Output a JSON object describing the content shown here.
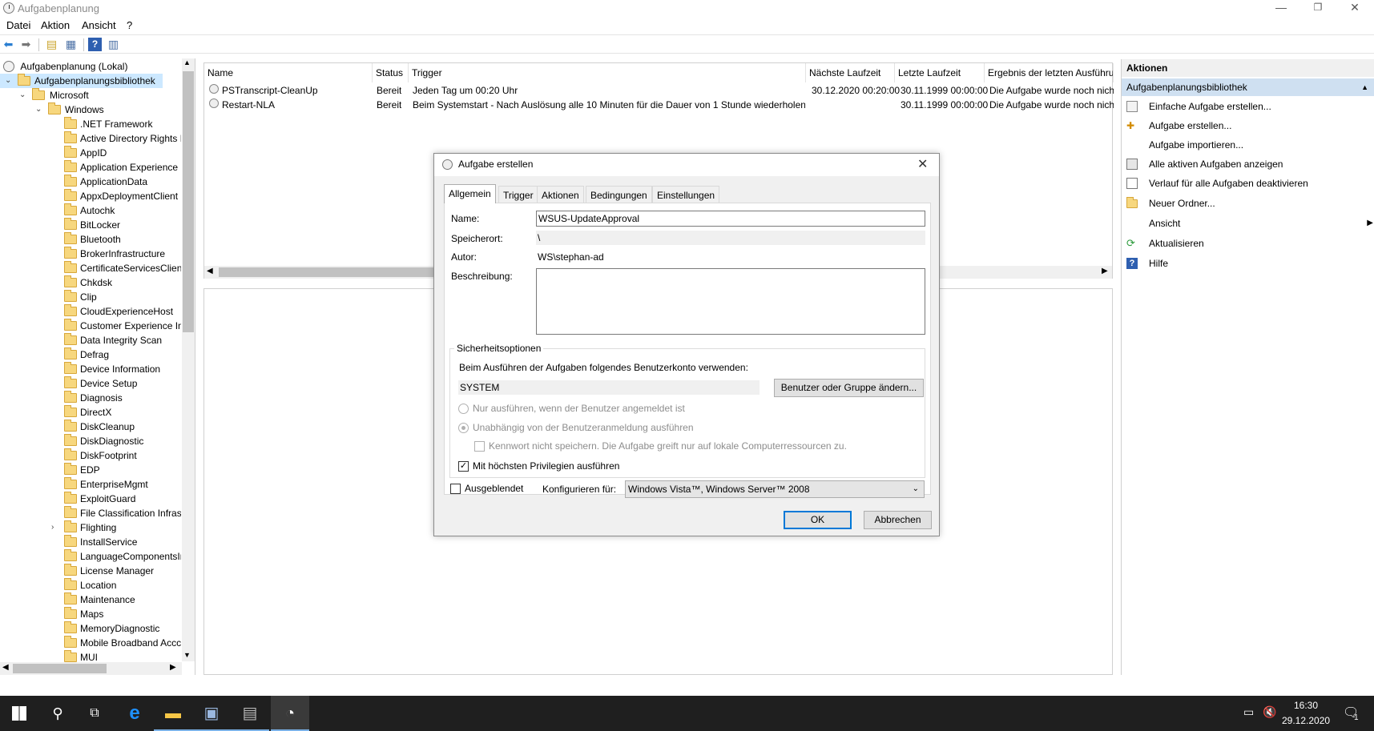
{
  "window": {
    "title": "Aufgabenplanung",
    "controls": {
      "minimize": "—",
      "restore": "❐",
      "close": "✕"
    }
  },
  "menu": [
    "Datei",
    "Aktion",
    "Ansicht",
    "?"
  ],
  "tree": {
    "root": "Aufgabenplanung (Lokal)",
    "library": "Aufgabenplanungsbibliothek",
    "microsoft": "Microsoft",
    "windows": "Windows",
    "folders": [
      ".NET Framework",
      "Active Directory Rights M",
      "AppID",
      "Application Experience",
      "ApplicationData",
      "AppxDeploymentClient",
      "Autochk",
      "BitLocker",
      "Bluetooth",
      "BrokerInfrastructure",
      "CertificateServicesClient",
      "Chkdsk",
      "Clip",
      "CloudExperienceHost",
      "Customer Experience Im",
      "Data Integrity Scan",
      "Defrag",
      "Device Information",
      "Device Setup",
      "Diagnosis",
      "DirectX",
      "DiskCleanup",
      "DiskDiagnostic",
      "DiskFootprint",
      "EDP",
      "EnterpriseMgmt",
      "ExploitGuard",
      "File Classification Infrast",
      "Flighting",
      "InstallService",
      "LanguageComponentsIr",
      "License Manager",
      "Location",
      "Maintenance",
      "Maps",
      "MemoryDiagnostic",
      "Mobile Broadband Accc",
      "MUI"
    ]
  },
  "tasklist": {
    "columns": [
      "Name",
      "Status",
      "Trigger",
      "Nächste Laufzeit",
      "Letzte Laufzeit",
      "Ergebnis der letzten Ausführu"
    ],
    "rows": [
      [
        "PSTranscript-CleanUp",
        "Bereit",
        "Jeden Tag um 00:20 Uhr",
        "30.12.2020 00:20:00",
        "30.11.1999 00:00:00",
        "Die Aufgabe wurde noch nich"
      ],
      [
        "Restart-NLA",
        "Bereit",
        "Beim Systemstart - Nach Auslösung alle 10 Minuten für die Dauer von 1 Stunde wiederholen.",
        "",
        "30.11.1999 00:00:00",
        "Die Aufgabe wurde noch nich"
      ]
    ]
  },
  "actions": {
    "header": "Aktionen",
    "section": "Aufgabenplanungsbibliothek",
    "items": [
      "Einfache Aufgabe erstellen...",
      "Aufgabe erstellen...",
      "Aufgabe importieren...",
      "Alle aktiven Aufgaben anzeigen",
      "Verlauf für alle Aufgaben deaktivieren",
      "Neuer Ordner...",
      "Ansicht",
      "Aktualisieren",
      "Hilfe"
    ]
  },
  "dialog": {
    "title": "Aufgabe erstellen",
    "tabs": [
      "Allgemein",
      "Trigger",
      "Aktionen",
      "Bedingungen",
      "Einstellungen"
    ],
    "name_label": "Name:",
    "name_value": "WSUS-UpdateApproval",
    "location_label": "Speicherort:",
    "location_value": "\\",
    "author_label": "Autor:",
    "author_value": "WS\\stephan-ad",
    "description_label": "Beschreibung:",
    "description_value": "",
    "security": {
      "title": "Sicherheitsoptionen",
      "account_text": "Beim Ausführen der Aufgaben folgendes Benutzerkonto verwenden:",
      "account_value": "SYSTEM",
      "change_button": "Benutzer oder Gruppe ändern...",
      "radio_logged_on": "Nur ausführen, wenn der Benutzer angemeldet ist",
      "radio_independent": "Unabhängig von der Benutzeranmeldung ausführen",
      "no_password": "Kennwort nicht speichern. Die Aufgabe greift nur auf lokale Computerressourcen zu.",
      "highest_priv": "Mit höchsten Privilegien ausführen"
    },
    "hidden_label": "Ausgeblendet",
    "configure_label": "Konfigurieren für:",
    "configure_value": "Windows Vista™, Windows Server™ 2008",
    "ok": "OK",
    "cancel": "Abbrechen"
  },
  "taskbar": {
    "time": "16:30",
    "date": "29.12.2020",
    "notification_count": "1"
  }
}
